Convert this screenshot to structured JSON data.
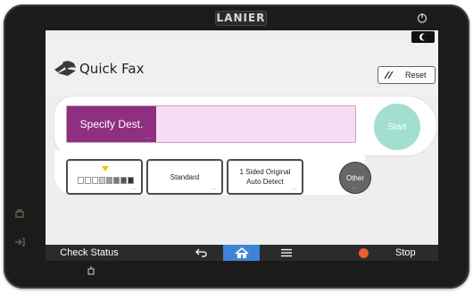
{
  "device": {
    "brand": "LANIER"
  },
  "header": {
    "title": "Quick Fax",
    "reset_label": "Reset"
  },
  "destination": {
    "label": "Specify Dest."
  },
  "start": {
    "label": "Start"
  },
  "options": {
    "density": {
      "level": 3,
      "steps": 8,
      "filled_from": 3
    },
    "resolution": {
      "label": "Standard"
    },
    "original": {
      "line1": "1 Sided Original",
      "line2": "Auto Detect"
    },
    "other": {
      "label": "Other"
    }
  },
  "bottom_bar": {
    "check_status": "Check Status",
    "stop": "Stop"
  },
  "colors": {
    "accent_purple": "#8e2f80",
    "dest_field": "#f7ddf3",
    "start_teal": "#a2dfd0",
    "home_blue": "#3e84d8",
    "stop_orange": "#e8602c",
    "density_marker": "#f0c400"
  },
  "icons": {
    "fax": "fax-icon",
    "reset": "reset-icon",
    "sleep": "moon-icon",
    "power": "power-icon",
    "back": "back-arrow-icon",
    "home": "home-icon",
    "menu": "menu-icon",
    "stop": "stop-icon"
  }
}
